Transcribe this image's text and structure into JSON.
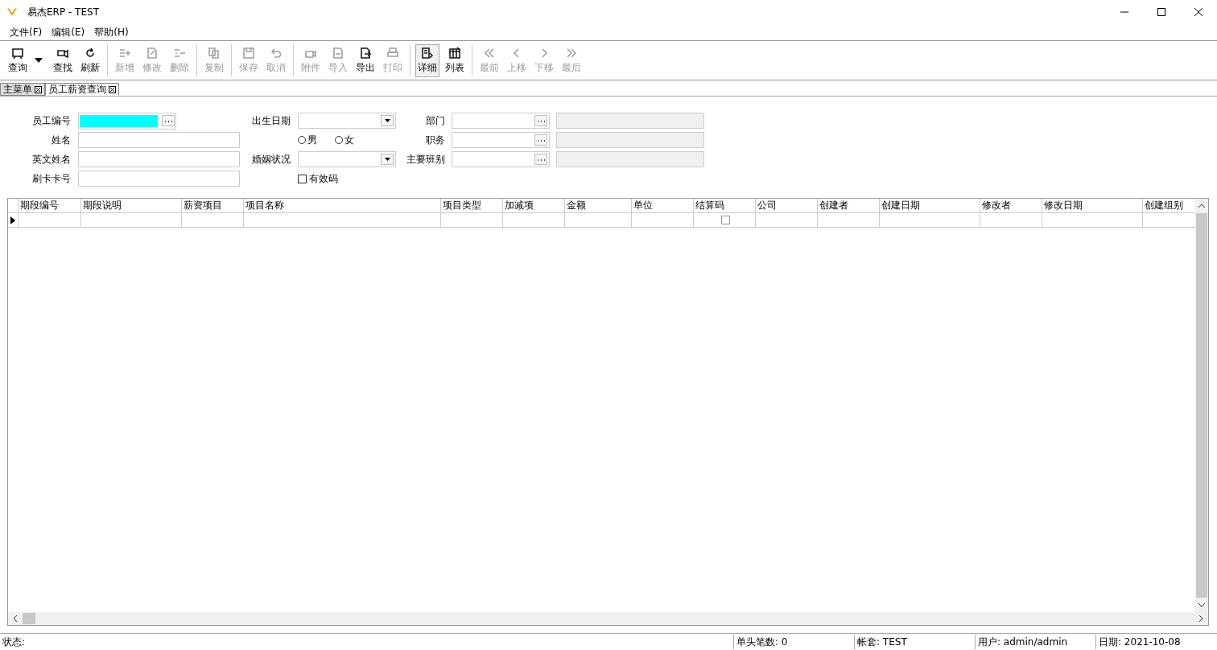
{
  "window": {
    "title": "易杰ERP - TEST"
  },
  "menu": [
    "文件(F)",
    "编辑(E)",
    "帮助(H)"
  ],
  "toolbar": [
    [
      {
        "label": "查询",
        "kind": "split",
        "disabled": false,
        "pressed": false
      },
      {
        "label": "查找",
        "kind": "button",
        "disabled": false,
        "pressed": false
      },
      {
        "label": "刷新",
        "kind": "button",
        "disabled": false,
        "pressed": false
      }
    ],
    [
      {
        "label": "新增",
        "kind": "button",
        "disabled": true,
        "pressed": false
      },
      {
        "label": "修改",
        "kind": "button",
        "disabled": true,
        "pressed": false
      },
      {
        "label": "删除",
        "kind": "button",
        "disabled": true,
        "pressed": false
      }
    ],
    [
      {
        "label": "复制",
        "kind": "button",
        "disabled": true,
        "pressed": false
      }
    ],
    [
      {
        "label": "保存",
        "kind": "button",
        "disabled": true,
        "pressed": false
      },
      {
        "label": "取消",
        "kind": "button",
        "disabled": true,
        "pressed": false
      }
    ],
    [
      {
        "label": "附件",
        "kind": "button",
        "disabled": true,
        "pressed": false
      },
      {
        "label": "导入",
        "kind": "button",
        "disabled": true,
        "pressed": false
      },
      {
        "label": "导出",
        "kind": "button",
        "disabled": false,
        "pressed": false
      },
      {
        "label": "打印",
        "kind": "button",
        "disabled": true,
        "pressed": false
      }
    ],
    [
      {
        "label": "详细",
        "kind": "button",
        "disabled": false,
        "pressed": true
      },
      {
        "label": "列表",
        "kind": "button",
        "disabled": false,
        "pressed": false
      }
    ],
    [
      {
        "label": "最前",
        "kind": "button",
        "disabled": true,
        "pressed": false
      },
      {
        "label": "上移",
        "kind": "button",
        "disabled": true,
        "pressed": false
      },
      {
        "label": "下移",
        "kind": "button",
        "disabled": true,
        "pressed": false
      },
      {
        "label": "最后",
        "kind": "button",
        "disabled": true,
        "pressed": false
      }
    ]
  ],
  "tabs": [
    {
      "label": "主菜单",
      "selected": false
    },
    {
      "label": "员工薪资查询",
      "selected": true
    }
  ],
  "form": {
    "left": [
      {
        "label": "员工编号",
        "kind": "lookup",
        "focused": true
      },
      {
        "label": "姓名",
        "kind": "text",
        "focused": false
      },
      {
        "label": "英文姓名",
        "kind": "text",
        "focused": false
      },
      {
        "label": "刷卡卡号",
        "kind": "text",
        "focused": false
      }
    ],
    "birth_date": {
      "label": "出生日期"
    },
    "gender": [
      {
        "label": "男",
        "selected": false
      },
      {
        "label": "女",
        "selected": false
      }
    ],
    "marital_status": {
      "label": "婚姻状况"
    },
    "valid_code": {
      "label": "有效码",
      "checked": false
    },
    "right": [
      {
        "label": "部门"
      },
      {
        "label": "职务"
      },
      {
        "label": "主要班别"
      }
    ]
  },
  "table": {
    "columns": [
      {
        "label": "期段编号",
        "kind": "text"
      },
      {
        "label": "期段说明",
        "kind": "text"
      },
      {
        "label": "薪资项目",
        "kind": "text"
      },
      {
        "label": "项目名称",
        "kind": "text"
      },
      {
        "label": "项目类型",
        "kind": "text"
      },
      {
        "label": "加减项",
        "kind": "text"
      },
      {
        "label": "金额",
        "kind": "text"
      },
      {
        "label": "单位",
        "kind": "text"
      },
      {
        "label": "结算码",
        "kind": "check"
      },
      {
        "label": "公司",
        "kind": "text"
      },
      {
        "label": "创建者",
        "kind": "text"
      },
      {
        "label": "创建日期",
        "kind": "text"
      },
      {
        "label": "修改者",
        "kind": "text"
      },
      {
        "label": "修改日期",
        "kind": "text"
      },
      {
        "label": "创建组别",
        "kind": "text"
      }
    ],
    "rows": [
      {
        "current": true,
        "checked": false
      }
    ]
  },
  "status_bar": [
    "状态:",
    "单头笔数: 0",
    "帐套: TEST",
    "用户: admin/admin",
    "日期: 2021-10-08"
  ]
}
